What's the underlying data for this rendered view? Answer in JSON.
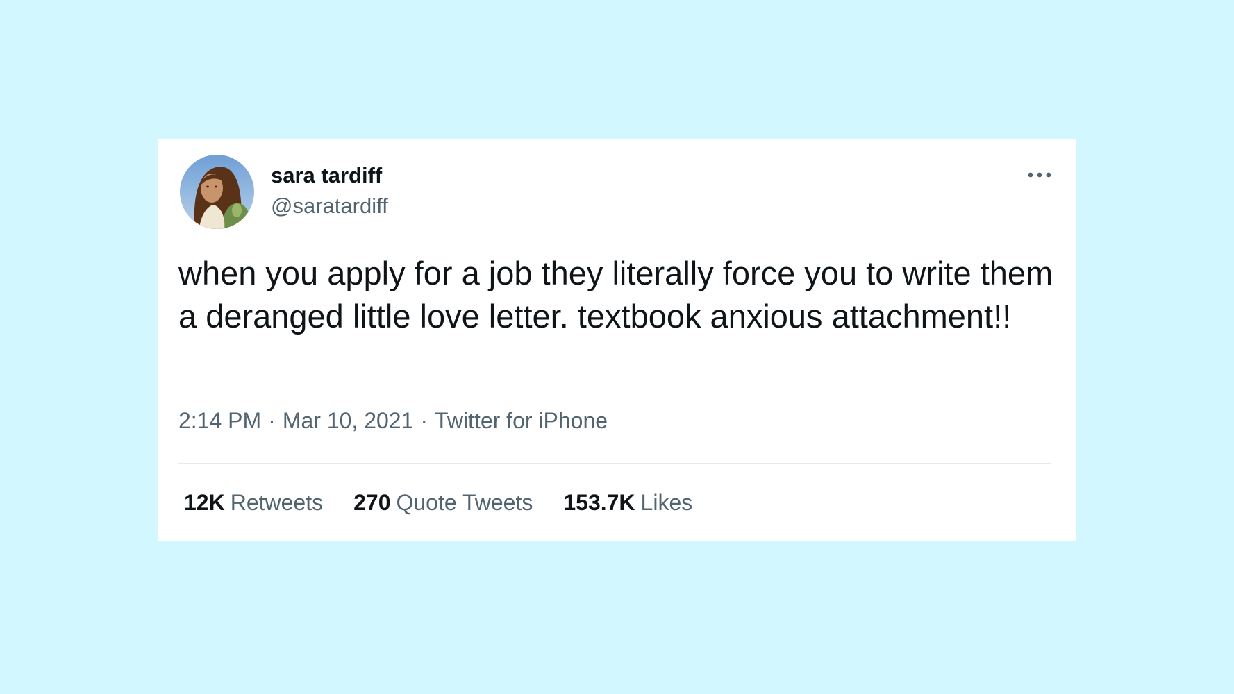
{
  "tweet": {
    "author": {
      "name": "sara tardiff",
      "handle": "@saratardiff"
    },
    "text": "when you apply for a job they literally force you to write them a deranged little love letter. textbook anxious attachment!!",
    "meta": {
      "time": "2:14 PM",
      "separator": "·",
      "date": "Mar 10, 2021",
      "source": "Twitter for iPhone"
    },
    "stats": {
      "retweets": {
        "count": "12K",
        "label": "Retweets"
      },
      "quotes": {
        "count": "270",
        "label": "Quote Tweets"
      },
      "likes": {
        "count": "153.7K",
        "label": "Likes"
      }
    },
    "more_icon": "more-horizontal-icon"
  },
  "colors": {
    "background": "#d3f7ff",
    "card": "#ffffff",
    "text_primary": "#0f1419",
    "text_secondary": "#536471"
  }
}
